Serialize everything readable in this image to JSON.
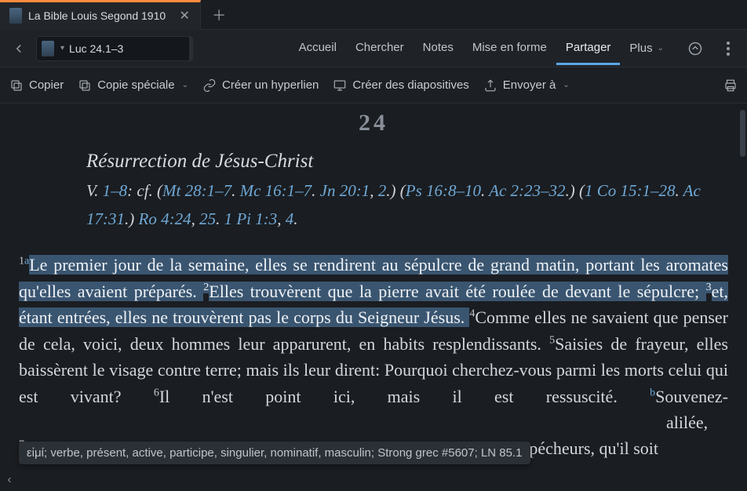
{
  "tab": {
    "title": "La Bible Louis Segond 1910"
  },
  "ref": {
    "text": "Luc 24.1–3"
  },
  "navTabs": {
    "accueil": "Accueil",
    "chercher": "Chercher",
    "notes": "Notes",
    "miseEnForme": "Mise en forme",
    "partager": "Partager",
    "plus": "Plus"
  },
  "toolbar": {
    "copier": "Copier",
    "copieSpeciale": "Copie spéciale",
    "hyperlien": "Créer un hyperlien",
    "diapositives": "Créer des diapositives",
    "envoyer": "Envoyer à"
  },
  "chapter": "24",
  "sectionTitle": "Résurrection de Jésus-Christ",
  "refsPrefix": "V. ",
  "refsRange": "1–8",
  "refsCf": ": cf. (",
  "links": {
    "mt": "Mt 28:1–7",
    "mc": "Mc 16:1–7",
    "jn1": "Jn 20:1",
    "jn2": "2",
    "ps": "Ps 16:8–10",
    "ac2": "Ac 2:23–32",
    "co": "1 Co 15:1–28",
    "ac17": "Ac 17:31",
    "ro1": "Ro 4:24",
    "ro2": "25",
    "pi1": "1 Pi 1:3",
    "pi2": "4"
  },
  "verses": {
    "v1n": "1",
    "v1fn": "a",
    "v1": "Le premier jour de la semaine, elles se rendirent au sépulcre de grand matin, portant les aromates qu'elles avaient préparés. ",
    "v2n": "2",
    "v2": "Elles trouvèrent que la pierre avait été roulée de devant le sépulcre; ",
    "v3n": "3",
    "v3": "et, étant entrées, elles ne trouvèrent pas le corps du Seigneur Jésus. ",
    "v4n": "4",
    "v4": "Comme elles ne savaient que penser de cela, voici, deux hommes leur apparurent, en habits resplendissants. ",
    "v5n": "5",
    "v5": "Saisies de frayeur, elles baissèrent le visage contre terre; mais ils leur dirent: Pourquoi cherchez-vous parmi les morts celui qui est vivant? ",
    "v6n": "6",
    "v6a": "Il n'est point ici, mais il est ressuscité. ",
    "v6fn": "b",
    "v6b": "Souvenez-",
    "v6c": "alilée, ",
    "v7n": "7",
    "v7": "et qu'il disait: Il faut que le Fils de l'homme soit livré entre les mains des pécheurs, qu'il soit"
  },
  "tooltip": "εἰμί; verbe, présent, active, participe, singulier, nominatif, masculin; Strong grec #5607; LN 85.1"
}
